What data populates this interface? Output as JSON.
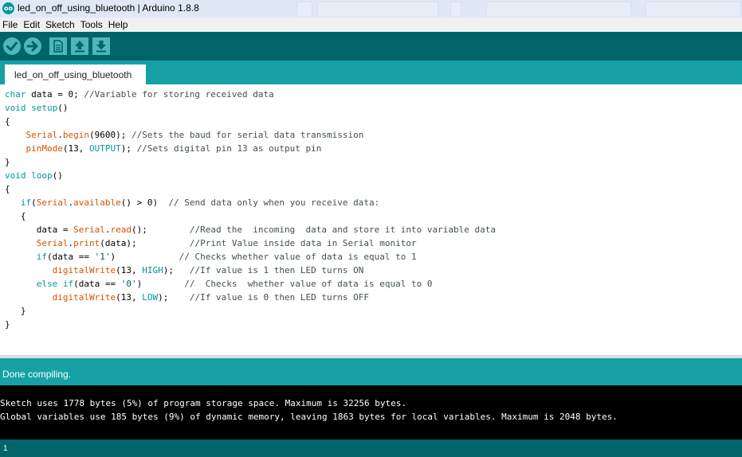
{
  "window": {
    "logo_text": "oo",
    "title": "led_on_off_using_bluetooth | Arduino 1.8.8"
  },
  "menu": [
    "File",
    "Edit",
    "Sketch",
    "Tools",
    "Help"
  ],
  "toolbar": {
    "verify_icon": "check-icon",
    "upload_icon": "arrow-right-icon",
    "new_icon": "document-icon",
    "open_icon": "arrow-up-icon",
    "save_icon": "arrow-down-icon"
  },
  "tab": {
    "label": "led_on_off_using_bluetooth"
  },
  "colors": {
    "toolbar_bg": "#006468",
    "teal": "#17a1a5",
    "keyword": "#00979c",
    "function": "#d35400",
    "comment": "#434f54"
  },
  "code": [
    [
      {
        "t": "char",
        "c": "kw"
      },
      {
        "t": " data = 0; "
      },
      {
        "t": "//Variable for storing received data",
        "c": "ct"
      }
    ],
    [
      {
        "t": "void",
        "c": "kw"
      },
      {
        "t": " "
      },
      {
        "t": "setup",
        "c": "kw"
      },
      {
        "t": "()"
      }
    ],
    [
      {
        "t": "{"
      }
    ],
    [
      {
        "t": "    "
      },
      {
        "t": "Serial",
        "c": "fn"
      },
      {
        "t": "."
      },
      {
        "t": "begin",
        "c": "fn"
      },
      {
        "t": "(9600); "
      },
      {
        "t": "//Sets the baud for serial data transmission",
        "c": "ct"
      }
    ],
    [
      {
        "t": "    "
      },
      {
        "t": "pinMode",
        "c": "fn"
      },
      {
        "t": "(13, "
      },
      {
        "t": "OUTPUT",
        "c": "kw"
      },
      {
        "t": "); "
      },
      {
        "t": "//Sets digital pin 13 as output pin",
        "c": "ct"
      }
    ],
    [
      {
        "t": "}"
      }
    ],
    [
      {
        "t": "void",
        "c": "kw"
      },
      {
        "t": " "
      },
      {
        "t": "loop",
        "c": "kw"
      },
      {
        "t": "()"
      }
    ],
    [
      {
        "t": "{"
      }
    ],
    [
      {
        "t": "   "
      },
      {
        "t": "if",
        "c": "kw"
      },
      {
        "t": "("
      },
      {
        "t": "Serial",
        "c": "fn"
      },
      {
        "t": "."
      },
      {
        "t": "available",
        "c": "fn"
      },
      {
        "t": "() > 0)  "
      },
      {
        "t": "// Send data only when you receive data:",
        "c": "ct"
      }
    ],
    [
      {
        "t": "   {"
      }
    ],
    [
      {
        "t": "      data = "
      },
      {
        "t": "Serial",
        "c": "fn"
      },
      {
        "t": "."
      },
      {
        "t": "read",
        "c": "fn"
      },
      {
        "t": "();        "
      },
      {
        "t": "//Read the  incoming  data and store it into variable data",
        "c": "ct"
      }
    ],
    [
      {
        "t": "      "
      },
      {
        "t": "Serial",
        "c": "fn"
      },
      {
        "t": "."
      },
      {
        "t": "print",
        "c": "fn"
      },
      {
        "t": "(data);          "
      },
      {
        "t": "//Print Value inside data in Serial monitor",
        "c": "ct"
      }
    ],
    [
      {
        "t": "      "
      },
      {
        "t": "if",
        "c": "kw"
      },
      {
        "t": "(data == "
      },
      {
        "t": "'1'",
        "c": "st"
      },
      {
        "t": ")            "
      },
      {
        "t": "// Checks whether value of data is equal to 1",
        "c": "ct"
      }
    ],
    [
      {
        "t": "         "
      },
      {
        "t": "digitalWrite",
        "c": "fn"
      },
      {
        "t": "(13, "
      },
      {
        "t": "HIGH",
        "c": "kw"
      },
      {
        "t": ");   "
      },
      {
        "t": "//If value is 1 then LED turns ON",
        "c": "ct"
      }
    ],
    [
      {
        "t": "      "
      },
      {
        "t": "else",
        "c": "kw"
      },
      {
        "t": " "
      },
      {
        "t": "if",
        "c": "kw"
      },
      {
        "t": "(data == "
      },
      {
        "t": "'0'",
        "c": "st"
      },
      {
        "t": ")        "
      },
      {
        "t": "//  Checks  whether value of data is equal to 0",
        "c": "ct"
      }
    ],
    [
      {
        "t": "         "
      },
      {
        "t": "digitalWrite",
        "c": "fn"
      },
      {
        "t": "(13, "
      },
      {
        "t": "LOW",
        "c": "kw"
      },
      {
        "t": ");    "
      },
      {
        "t": "//If value is 0 then LED turns OFF",
        "c": "ct"
      }
    ],
    [
      {
        "t": "   }"
      }
    ],
    [
      {
        "t": "}"
      }
    ]
  ],
  "status": {
    "message": "Done compiling."
  },
  "console": {
    "line1": "Sketch uses 1778 bytes (5%) of program storage space. Maximum is 32256 bytes.",
    "line2": "Global variables use 185 bytes (9%) of dynamic memory, leaving 1863 bytes for local variables. Maximum is 2048 bytes."
  },
  "footer": {
    "line_number": "1"
  }
}
